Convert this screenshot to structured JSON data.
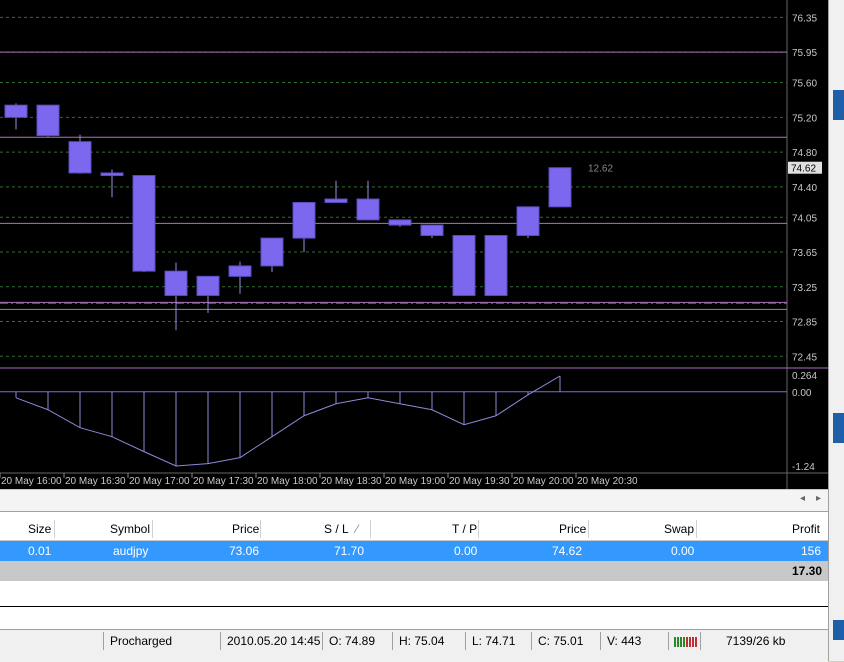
{
  "chart": {
    "price_axis_labels": [
      "76.35",
      "75.95",
      "75.60",
      "75.20",
      "74.80",
      "74.40",
      "74.05",
      "73.65",
      "73.25",
      "72.85",
      "72.45"
    ],
    "current_price_label": "74.62",
    "time_axis_labels": [
      "20 May 16:00",
      "20 May 16:30",
      "20 May 17:00",
      "20 May 17:30",
      "20 May 18:00",
      "20 May 18:30",
      "20 May 19:00",
      "20 May 19:30",
      "20 May 20:00",
      "20 May 20:30"
    ],
    "indicator_labels": {
      "top": "0.264",
      "zero": "0.00",
      "bottom": "-1.24"
    },
    "crosshair_readout": "12.62",
    "colors": {
      "background": "#000000",
      "candle": "#7b68ee",
      "axis_text": "#c8c8c8",
      "level_line": "#b070c0",
      "grid": "#2f6f2f"
    }
  },
  "chart_data": {
    "type": "candlestick",
    "candles": [
      {
        "open": 75.2,
        "high": 75.36,
        "low": 75.06,
        "close": 75.34
      },
      {
        "open": 75.34,
        "high": 75.34,
        "low": 74.98,
        "close": 74.99
      },
      {
        "open": 74.92,
        "high": 75.0,
        "low": 74.55,
        "close": 74.56
      },
      {
        "open": 74.56,
        "high": 74.6,
        "low": 74.28,
        "close": 74.53
      },
      {
        "open": 74.53,
        "high": 74.53,
        "low": 73.42,
        "close": 73.43
      },
      {
        "open": 73.43,
        "high": 73.53,
        "low": 72.75,
        "close": 73.15
      },
      {
        "open": 73.15,
        "high": 73.26,
        "low": 72.95,
        "close": 73.37
      },
      {
        "open": 73.37,
        "high": 73.54,
        "low": 73.17,
        "close": 73.49
      },
      {
        "open": 73.49,
        "high": 73.81,
        "low": 73.42,
        "close": 73.81
      },
      {
        "open": 73.81,
        "high": 74.22,
        "low": 73.65,
        "close": 74.22
      },
      {
        "open": 74.22,
        "high": 74.47,
        "low": 74.22,
        "close": 74.26
      },
      {
        "open": 74.26,
        "high": 74.47,
        "low": 74.02,
        "close": 74.02
      },
      {
        "open": 74.02,
        "high": 74.02,
        "low": 73.94,
        "close": 73.96
      },
      {
        "open": 73.96,
        "high": 73.96,
        "low": 73.81,
        "close": 73.84
      },
      {
        "open": 73.84,
        "high": 73.84,
        "low": 73.15,
        "close": 73.15
      },
      {
        "open": 73.15,
        "high": 73.84,
        "low": 73.15,
        "close": 73.84
      },
      {
        "open": 73.84,
        "high": 74.17,
        "low": 73.81,
        "close": 74.17
      },
      {
        "open": 74.17,
        "high": 74.62,
        "low": 74.17,
        "close": 74.62
      }
    ],
    "oscillator": [
      -0.1,
      -0.3,
      -0.6,
      -0.75,
      -1.0,
      -1.24,
      -1.2,
      -1.1,
      -0.75,
      -0.4,
      -0.2,
      -0.1,
      -0.2,
      -0.3,
      -0.55,
      -0.4,
      -0.05,
      0.264
    ],
    "levels": [
      75.95,
      74.97,
      73.98,
      73.06,
      72.99,
      73.07
    ],
    "y_range": [
      72.35,
      76.55
    ]
  },
  "terminal": {
    "headers": [
      "Size",
      "Symbol",
      "Price",
      "S / L",
      "T / P",
      "Price",
      "Swap",
      "Profit"
    ],
    "row": {
      "size": "0.01",
      "symbol": "audjpy",
      "price": "73.06",
      "sl": "71.70",
      "tp": "0.00",
      "cur_price": "74.62",
      "swap": "0.00",
      "profit": "156"
    },
    "total": "17.30"
  },
  "status": {
    "profile": "Procharged",
    "datetime": "2010.05.20 14:45",
    "open": "O: 74.89",
    "high": "H: 75.04",
    "low": "L: 74.71",
    "close": "C: 75.01",
    "volume": "V: 443",
    "traffic": "7139/26 kb"
  }
}
